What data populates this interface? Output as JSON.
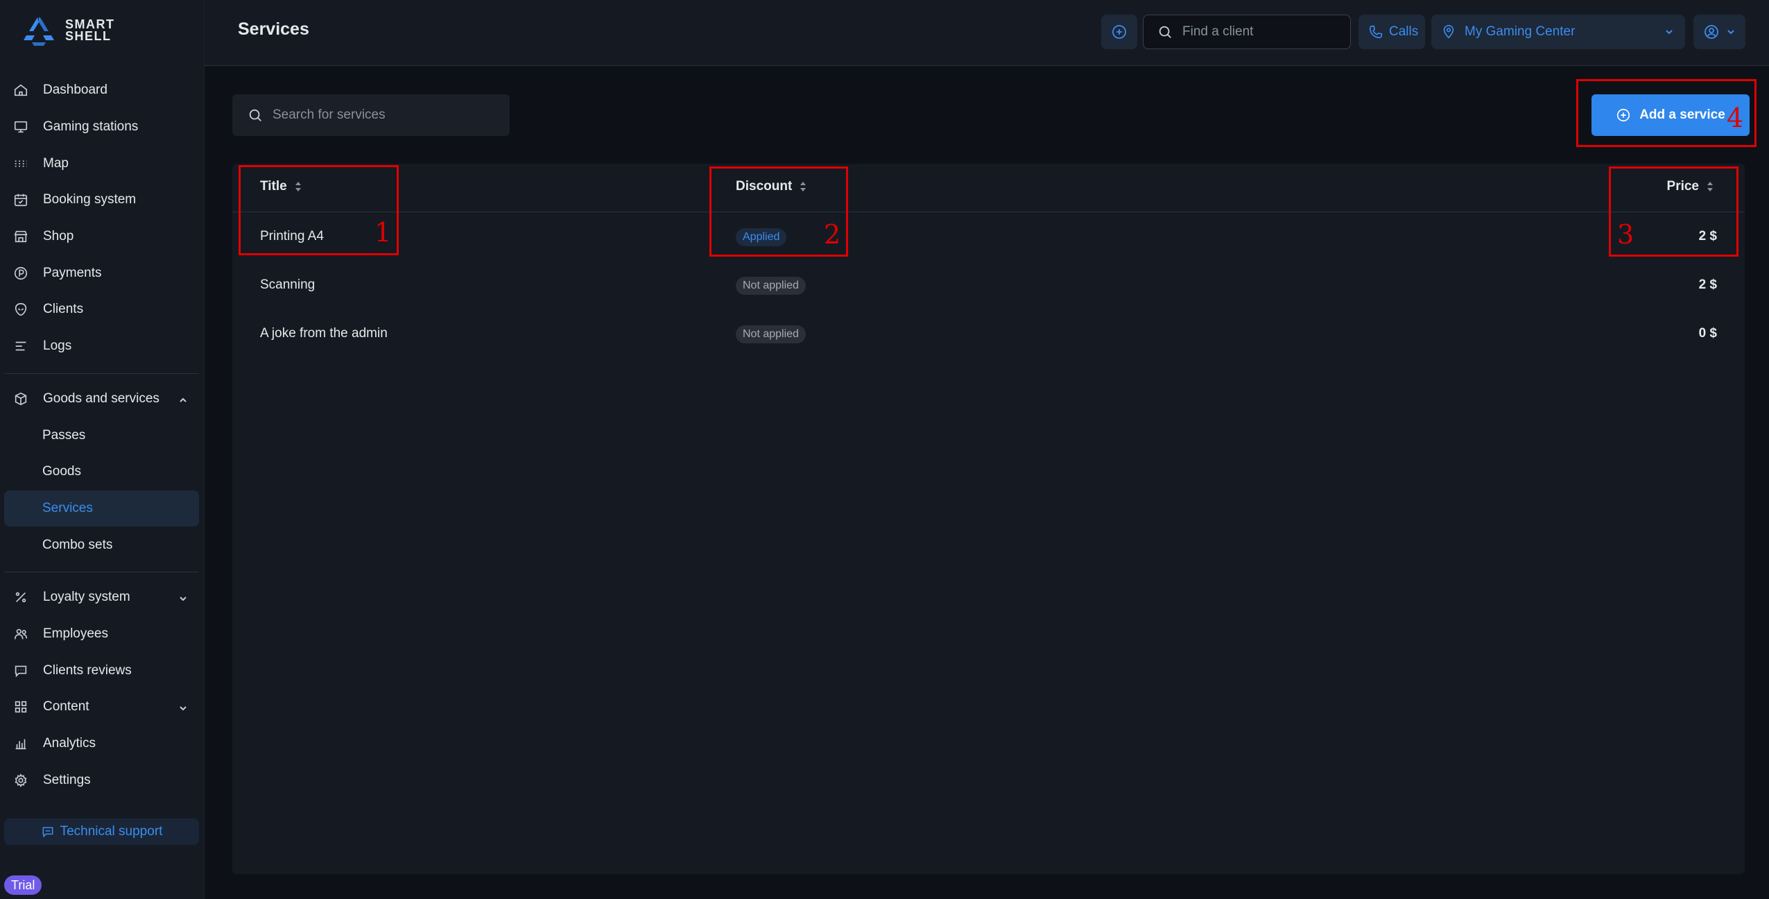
{
  "brand": {
    "logo_line1": "SMART",
    "logo_line2": "SHELL"
  },
  "header": {
    "title": "Services",
    "find_placeholder": "Find a client",
    "calls_label": "Calls",
    "center_label": "My Gaming Center"
  },
  "sidebar": {
    "items": [
      {
        "label": "Dashboard",
        "icon": "home-icon"
      },
      {
        "label": "Gaming stations",
        "icon": "monitor-icon"
      },
      {
        "label": "Map",
        "icon": "grid-dots-icon"
      },
      {
        "label": "Booking system",
        "icon": "calendar-icon"
      },
      {
        "label": "Shop",
        "icon": "store-icon"
      },
      {
        "label": "Payments",
        "icon": "coin-icon"
      },
      {
        "label": "Clients",
        "icon": "alien-icon"
      },
      {
        "label": "Logs",
        "icon": "list-icon"
      }
    ],
    "goods_group": {
      "label": "Goods and services",
      "icon": "box-icon"
    },
    "sub_items": [
      "Passes",
      "Goods",
      "Services",
      "Combo sets"
    ],
    "active_sub": "Services",
    "bottom_items": [
      {
        "label": "Loyalty system",
        "icon": "percent-icon",
        "expandable": true
      },
      {
        "label": "Employees",
        "icon": "users-icon"
      },
      {
        "label": "Clients reviews",
        "icon": "message-icon"
      },
      {
        "label": "Content",
        "icon": "tiles-icon",
        "expandable": true
      },
      {
        "label": "Analytics",
        "icon": "bar-chart-icon"
      },
      {
        "label": "Settings",
        "icon": "gear-icon"
      }
    ],
    "support_label": "Technical support",
    "trial_label": "Trial"
  },
  "main": {
    "search_placeholder": "Search for services",
    "add_button_label": "Add a service",
    "table": {
      "columns": {
        "title": "Title",
        "discount": "Discount",
        "price": "Price"
      },
      "rows": [
        {
          "title": "Printing A4",
          "discount": "Applied",
          "applied": true,
          "price": "2 $"
        },
        {
          "title": "Scanning",
          "discount": "Not applied",
          "applied": false,
          "price": "2 $"
        },
        {
          "title": "A joke from the admin",
          "discount": "Not applied",
          "applied": false,
          "price": "0 $"
        }
      ]
    }
  },
  "annotations": [
    "1",
    "2",
    "3",
    "4"
  ],
  "colors": {
    "accent": "#2f86ec",
    "annotation": "#e00000",
    "trial": "#6f5be8"
  }
}
